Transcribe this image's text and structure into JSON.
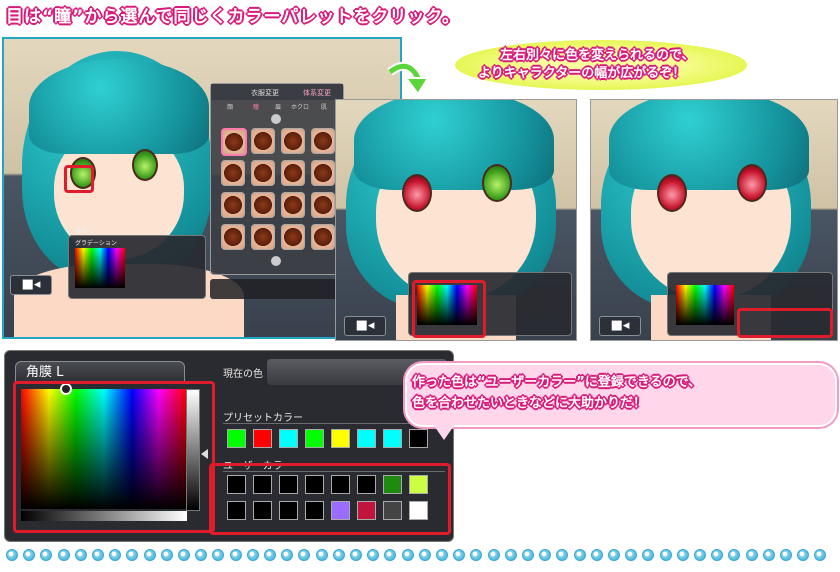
{
  "headline": "目は“瞳”から選んで同じくカラーパレットをクリック。",
  "bubble_top": {
    "line1": "左右別々に色を変えられるので、",
    "line2": "よりキャラクターの幅が広がるぞ！"
  },
  "bubble_bottom": {
    "line1": "作った色は“ユーザーカラー”に登録できるので、",
    "line2": "色を合わせたいときなどに大助かりだ！"
  },
  "costume_menu": {
    "tab_clothes": "衣服変更",
    "tab_body": "体系変更",
    "sub_tabs": [
      "顔",
      "瞳",
      "眉",
      "ホクロ",
      "肌"
    ]
  },
  "mini_panel": {
    "part_name": "角膜",
    "gradation_label": "グラデーション"
  },
  "big_panel": {
    "tab_label": "角膜 L",
    "current_color_label": "現在の色",
    "preset_label": "プリセットカラー",
    "user_label": "ユーザーカラー"
  },
  "colors": {
    "accent_pink": "#d81a7a",
    "frame_blue": "#22a6c6",
    "highlight_red": "#e01c2c",
    "bubble_yellow": "#e6f53a",
    "bubble_pink": "#ffd6ea"
  },
  "preset_colors": [
    "#00ff00",
    "#ff0000",
    "#00ffff",
    "#00ff00",
    "#ffff00",
    "#00ffff",
    "#00ffff",
    "#000000"
  ],
  "user_colors_row1": [
    "#000000",
    "#000000",
    "#000000",
    "#000000",
    "#000000",
    "#000000",
    "#1e8a10",
    "#ccff44"
  ],
  "user_colors_row2": [
    "#000000",
    "#000000",
    "#000000",
    "#000000",
    "#9a6cff",
    "#c0143c",
    "#444444",
    "#ffffff"
  ],
  "icons": [
    "camera-icon",
    "arrow-down-icon",
    "scroll-up-icon",
    "scroll-down-icon"
  ]
}
